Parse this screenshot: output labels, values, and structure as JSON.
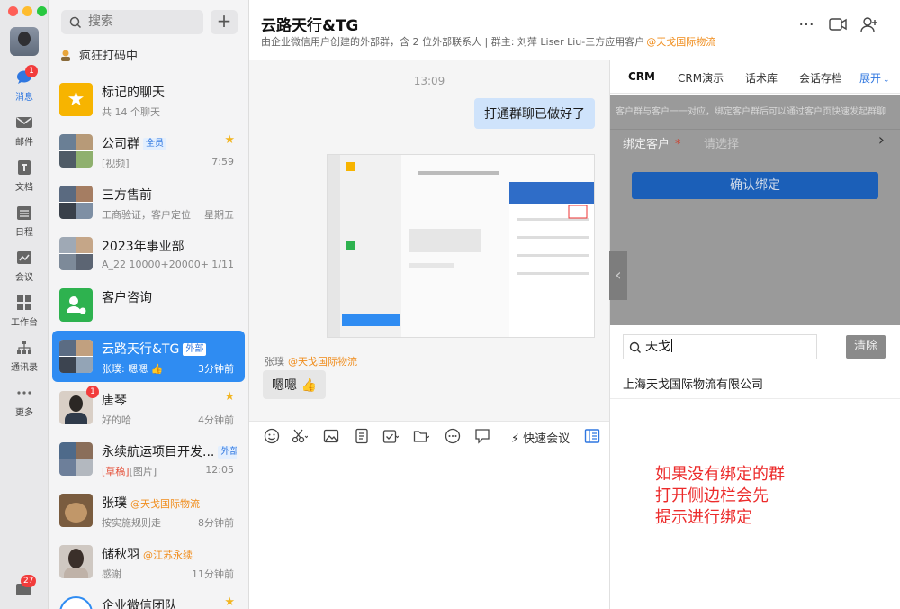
{
  "nav": {
    "items": [
      {
        "label": "消息",
        "icon": "message-icon",
        "badge": "1"
      },
      {
        "label": "邮件",
        "icon": "mail-icon"
      },
      {
        "label": "文档",
        "icon": "document-icon"
      },
      {
        "label": "日程",
        "icon": "calendar-icon"
      },
      {
        "label": "会议",
        "icon": "meeting-icon"
      },
      {
        "label": "工作台",
        "icon": "workbench-icon"
      },
      {
        "label": "通讯录",
        "icon": "contacts-icon"
      },
      {
        "label": "更多",
        "icon": "more-icon"
      }
    ],
    "bottom_badge": "27"
  },
  "list": {
    "search_placeholder": "搜索",
    "plus": "+",
    "status": "疯狂打码中",
    "chats": [
      {
        "name": "标记的聊天",
        "sub": "共 14 个聊天",
        "time": "",
        "tag": "",
        "org": "",
        "star": false
      },
      {
        "name": "公司群",
        "sub": "[视频]",
        "time": "7:59",
        "tag": "全员",
        "org": "",
        "star": true
      },
      {
        "name": "三方售前",
        "sub": "工商验证，客户定位...",
        "time": "星期五",
        "tag": "",
        "org": "",
        "star": false
      },
      {
        "name": "2023年事业部",
        "sub": "A_22  10000+20000+1...",
        "time": "1/11",
        "tag": "",
        "org": "",
        "star": false
      },
      {
        "name": "客户咨询",
        "sub": "",
        "time": "",
        "tag": "",
        "org": "",
        "star": false
      },
      {
        "name": "云路天行&TG",
        "sub": "张璞: 嗯嗯 👍",
        "time": "3分钟前",
        "tag": "外部",
        "org": "",
        "star": false
      },
      {
        "name": "唐琴",
        "sub": "好的哈",
        "time": "4分钟前",
        "tag": "",
        "org": "",
        "star": true,
        "badge": "1"
      },
      {
        "name": "永续航运项目开发...",
        "sub_draft": "[草稿]",
        "sub": "[图片]",
        "time": "12:05",
        "tag": "外部",
        "org": "",
        "star": false
      },
      {
        "name": "张璞",
        "sub": "按实施规则走",
        "time": "8分钟前",
        "tag": "",
        "org": "@天戈国际物流",
        "star": false
      },
      {
        "name": "储秋羽",
        "sub": "感谢",
        "time": "11分钟前",
        "tag": "",
        "org": "@江苏永续",
        "star": false
      },
      {
        "name": "企业微信团队",
        "sub": "",
        "time": "",
        "tag": "",
        "org": "",
        "star": true
      }
    ]
  },
  "header": {
    "title": "云路天行&TG",
    "subtitle": "由企业微信用户创建的外部群，含 2 位外部联系人 | 群主: 刘萍 Liser Liu-三方应用客户",
    "subtitle_org": "@天戈国际物流",
    "more": "···"
  },
  "chat": {
    "time": "13:09",
    "my_message": "打通群聊已做好了",
    "sender": "张璞",
    "sender_org": "@天戈国际物流",
    "reply": "嗯嗯 👍"
  },
  "toolbar": {
    "meeting": "快速会议"
  },
  "side": {
    "tabs": [
      "CRM",
      "CRM演示",
      "话术库",
      "会话存档",
      "展开"
    ],
    "notice": "客户群与客户一一对应，绑定客户群后可以通过客户页快速发起群聊",
    "bind_label": "绑定客户",
    "required": "*",
    "bind_placeholder": "请选择",
    "confirm": "确认绑定",
    "search_value": "天戈",
    "clear": "清除",
    "result": "上海天戈国际物流有限公司",
    "annotation": [
      "如果没有绑定的群",
      "打开侧边栏会先",
      "提示进行绑定"
    ]
  },
  "colors": {
    "accent": "#2f8cf2",
    "selected_chat": "#2f8cf2",
    "annotation": "#ec2b2b",
    "org": "#f08c1a",
    "badge": "#f23c3c"
  }
}
